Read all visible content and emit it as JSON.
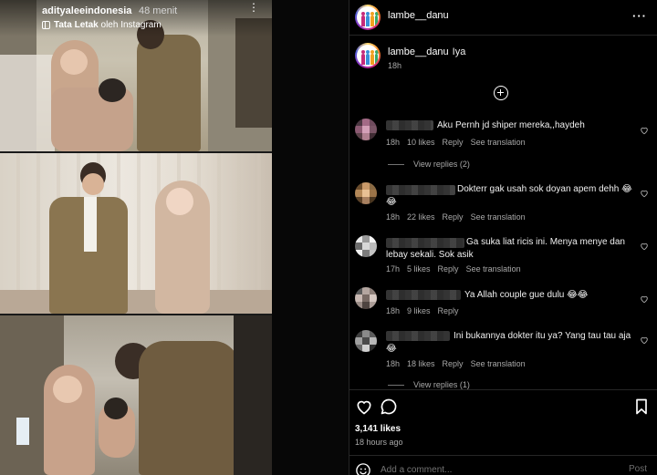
{
  "story": {
    "username": "adityaleeindonesia",
    "time": "48 menit",
    "layout_prefix": "Tata Letak",
    "layout_suffix": "oleh Instagram",
    "more_glyph": "⋮"
  },
  "post": {
    "username": "lambe__danu",
    "more_glyph": "···",
    "caption_text": "Iya",
    "caption_time": "18h",
    "likes": "3,141 likes",
    "time": "18 hours ago"
  },
  "comments": [
    {
      "text": "Aku Pernh jd shiper mereka,,haydeh",
      "time": "18h",
      "likes": "10 likes",
      "reply": "Reply",
      "translation": "See translation",
      "view_replies": "View replies (2)"
    },
    {
      "text": "Dokterr gak usah sok doyan apem dehh 😂😂",
      "time": "18h",
      "likes": "22 likes",
      "reply": "Reply",
      "translation": "See translation"
    },
    {
      "text": "Ga suka liat ricis ini. Menya menye dan lebay sekali. Sok asik",
      "time": "17h",
      "likes": "5 likes",
      "reply": "Reply",
      "translation": "See translation"
    },
    {
      "text": "Ya Allah couple gue dulu 😂😂",
      "time": "18h",
      "likes": "9 likes",
      "reply": "Reply"
    },
    {
      "text": "Ini bukannya dokter itu ya? Yang tau tau aja 😂",
      "time": "18h",
      "likes": "18 likes",
      "reply": "Reply",
      "translation": "See translation",
      "view_replies": "View replies (1)"
    }
  ],
  "comment_box": {
    "placeholder": "Add a comment...",
    "post_label": "Post"
  },
  "icons": {
    "actions": [
      "heart-icon",
      "comment-icon",
      "bookmark-icon"
    ],
    "misc": [
      "emoji-icon",
      "add-circle-icon",
      "layout-icon",
      "more-icon"
    ]
  },
  "colors": {
    "background": "#000000",
    "text": "#f5f5f5",
    "secondary_text": "#a8a8a8",
    "divider": "#262626"
  }
}
